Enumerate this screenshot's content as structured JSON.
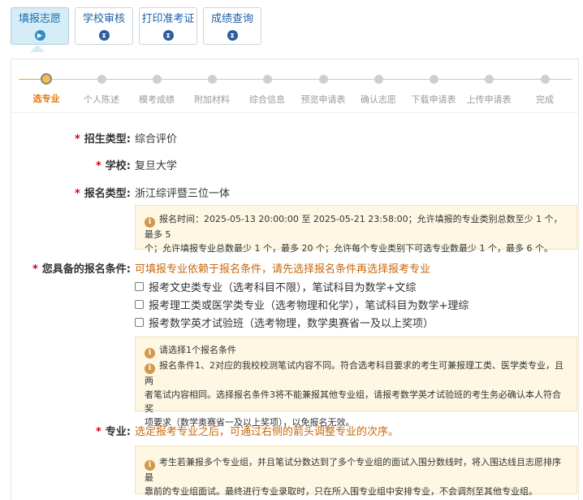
{
  "tabs": [
    {
      "label": "填报志愿",
      "icon": "play-circle-icon"
    },
    {
      "label": "学校审核",
      "icon": "hourglass-icon"
    },
    {
      "label": "打印准考证",
      "icon": "hourglass-icon"
    },
    {
      "label": "成绩查询",
      "icon": "hourglass-icon"
    }
  ],
  "steps": [
    "选专业",
    "个人陈述",
    "模考成绩",
    "附加材料",
    "综合信息",
    "预览申请表",
    "确认志愿",
    "下载申请表",
    "上传申请表",
    "完成"
  ],
  "colors": {
    "active_step": "#e8750d",
    "required": "#d0021b",
    "hint": "#c8690a",
    "notice_bg": "#fdf7e3"
  },
  "form": {
    "recruit_type": {
      "label": "招生类型:",
      "value": "综合评价"
    },
    "school": {
      "label": "学校:",
      "value": "复旦大学"
    },
    "apply_type": {
      "label": "报名类型:",
      "value": "浙江综评暨三位一体"
    },
    "notice1": {
      "line1": "报名时间：2025-05-13 20:00:00 至 2025-05-21 23:58:00；允许填报的专业类别总数至少 1 个，最多 5",
      "line2": "个；允许填报专业总数最少 1 个，最多 20 个；允许每个专业类别下可选专业数最少 1 个，最多 6 个。"
    },
    "conditions": {
      "label": "您具备的报名条件:",
      "hint": "可填报专业依赖于报名条件，请先选择报名条件再选择报考专业",
      "options": [
        "报考文史类专业（选考科目不限），笔试科目为数学+文综",
        "报考理工类或医学类专业（选考物理和化学），笔试科目为数学+理综",
        "报考数学英才试验班（选考物理，数学奥赛省一及以上奖项）"
      ]
    },
    "notice2": {
      "line1": "请选择1个报名条件",
      "line2": "报名条件1、2对应的我校校测笔试内容不同。符合选考科目要求的考生可兼报理工类、医学类专业，且两",
      "line3": "者笔试内容相同。选择报名条件3将不能兼报其他专业组，请报考数学英才试验班的考生务必确认本人符合奖",
      "line4": "项要求（数学奥赛省一及以上奖项），以免报名无效。"
    },
    "major": {
      "label": "专业:",
      "hint": "选定报考专业之后，可通过右侧的箭头调整专业的次序。"
    },
    "notice3": {
      "line1": "考生若兼报多个专业组，并且笔试分数达到了多个专业组的面试入围分数线时，将入围达线且志愿排序最",
      "line2": "靠前的专业组面试。最终进行专业录取时，只在所入围专业组中安排专业，不会调剂至其他专业组。"
    }
  }
}
